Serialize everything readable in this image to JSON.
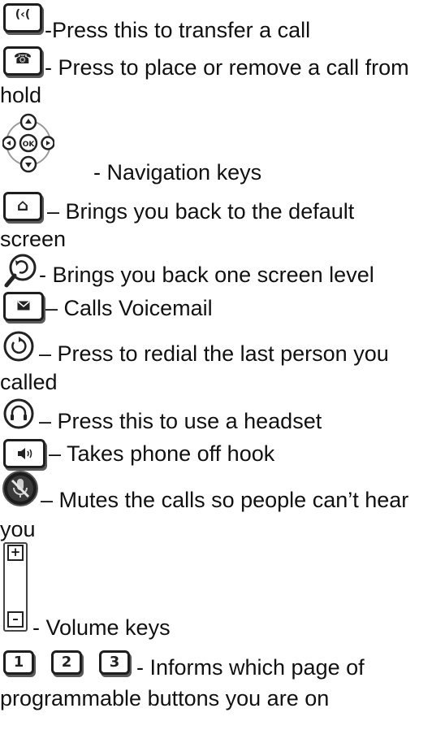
{
  "items": [
    {
      "icon": "transfer-icon",
      "glyph": "(‹(",
      "text": "-Press this to transfer a call"
    },
    {
      "icon": "hold-icon",
      "glyph": "☎",
      "text": "- Press to place or remove a call from",
      "text2": "hold"
    },
    {
      "icon": "navigation-keys-icon",
      "ok_label": "OK",
      "text": "- Navigation keys"
    },
    {
      "icon": "home-icon",
      "glyph": "⌂",
      "text": "– Brings you back to the default",
      "text2": "screen"
    },
    {
      "icon": "back-icon",
      "text": "- Brings you back one screen level"
    },
    {
      "icon": "voicemail-icon",
      "text": "– Calls Voicemail"
    },
    {
      "icon": "redial-icon",
      "glyph": "↻",
      "text": "– Press to redial the last person you",
      "text2": "called"
    },
    {
      "icon": "headset-icon",
      "text": "– Press this to use a headset"
    },
    {
      "icon": "speaker-icon",
      "text": "– Takes phone off hook"
    },
    {
      "icon": "mute-icon",
      "text": "– Mutes the calls so people can’t hear",
      "text2": "you"
    },
    {
      "icon": "volume-keys-icon",
      "plus": "+",
      "minus": "–",
      "text": "- Volume keys"
    },
    {
      "icon": "page-keys-icon",
      "keys": [
        "1",
        "2",
        "3"
      ],
      "text": "- Informs which page of",
      "text2": "programmable buttons you are on"
    }
  ]
}
